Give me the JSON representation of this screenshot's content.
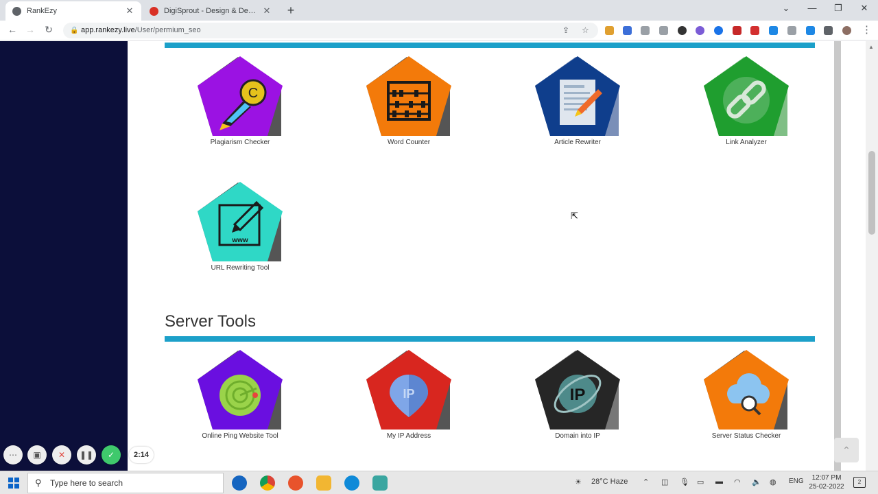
{
  "browser": {
    "tabs": [
      {
        "title": "RankEzy",
        "active": true
      },
      {
        "title": "DigiSprout - Design & Development",
        "active": false
      }
    ],
    "url_domain": "app.rankezy.live",
    "url_path": "/User/permium_seo"
  },
  "tools_top": [
    {
      "label": "Plagiarism Checker",
      "color": "#9b12e3",
      "icon": "pen-copyright-icon"
    },
    {
      "label": "Word Counter",
      "color": "#f37a0a",
      "icon": "abacus-icon"
    },
    {
      "label": "Article Rewriter",
      "color": "#0f3e8c",
      "icon": "document-pencil-icon"
    },
    {
      "label": "Link Analyzer",
      "color": "#1f9e2f",
      "icon": "chain-link-icon"
    },
    {
      "label": "URL Rewriting Tool",
      "color": "#2fd8c6",
      "icon": "www-pencil-icon"
    }
  ],
  "server_section": {
    "title": "Server Tools"
  },
  "tools_server": [
    {
      "label": "Online Ping Website Tool",
      "color": "#6a0fe0",
      "icon": "radar-icon"
    },
    {
      "label": "My IP Address",
      "color": "#d8261f",
      "icon": "ip-pin-icon"
    },
    {
      "label": "Domain into IP",
      "color": "#262626",
      "icon": "ip-globe-icon"
    },
    {
      "label": "Server Status Checker",
      "color": "#f37a0a",
      "icon": "cloud-search-icon"
    }
  ],
  "recorder": {
    "time": "2:14"
  },
  "taskbar": {
    "search_placeholder": "Type here to search",
    "weather": "28°C  Haze",
    "lang": "ENG",
    "time": "12:07 PM",
    "date": "25-02-2022",
    "notifications": "2"
  }
}
